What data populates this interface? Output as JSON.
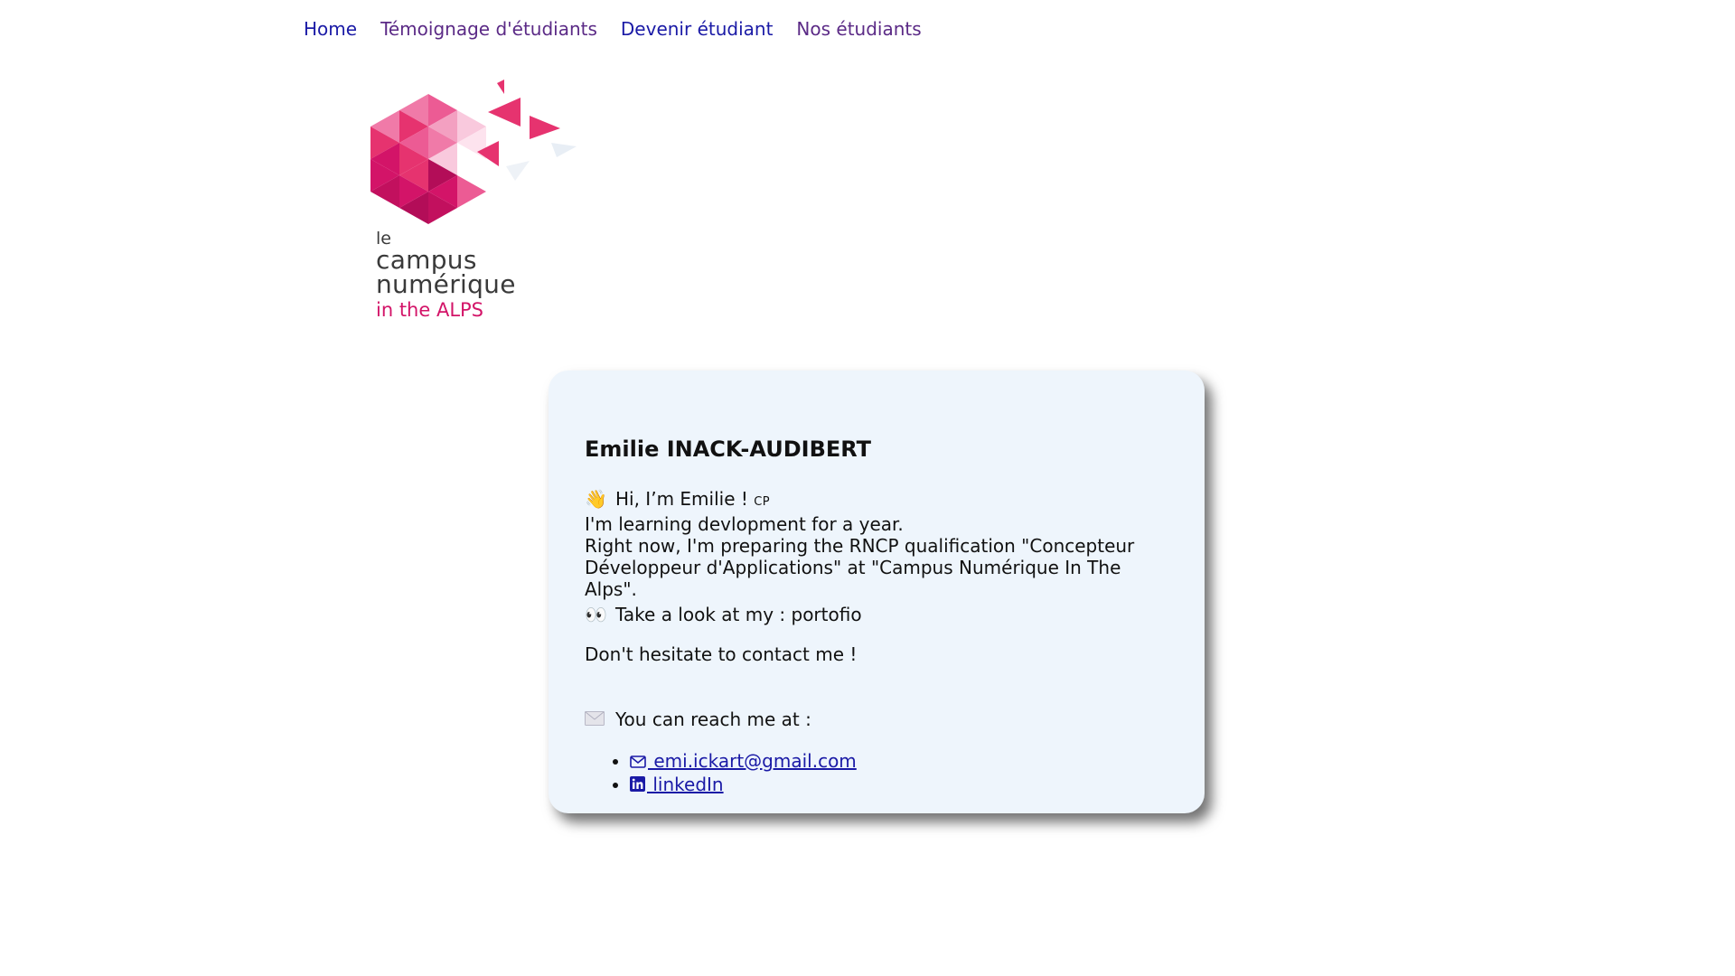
{
  "nav": {
    "items": [
      {
        "label": "Home",
        "state": "link"
      },
      {
        "label": "Témoignage d'étudiants",
        "state": "visited"
      },
      {
        "label": "Devenir étudiant",
        "state": "link"
      },
      {
        "label": "Nos étudiants",
        "state": "visited"
      }
    ]
  },
  "logo": {
    "le": "le",
    "line1": "campus",
    "line2": "numérique",
    "line3": "in the ALPS",
    "colors": {
      "pink": "#e6336f",
      "magenta": "#d31468",
      "text": "#3a3a3a"
    }
  },
  "card": {
    "title": "Emilie INACK-AUDIBERT",
    "greeting": "Hi, I’m Emilie !",
    "greeting_suffix": "CP",
    "greeting_icon": "waving-hand-icon",
    "learning": "I'm learning devlopment for a year.",
    "preparing": "Right now, I'm preparing the RNCP qualification \"Concepteur Développeur d'Applications\" at \"Campus Numérique In The Alps\".",
    "portfolio_icon": "eyes-icon",
    "portfolio": "Take a look at my : portofio",
    "contact": "Don't hesitate to contact me !",
    "reach_icon": "envelope-icon",
    "reach": "You can reach me at :",
    "links": [
      {
        "icon": "mail-icon",
        "label": " emi.ickart@gmail.com"
      },
      {
        "icon": "linkedin-icon",
        "label": " linkedIn"
      }
    ]
  },
  "colors": {
    "link": "#1a1aa6",
    "visited": "#5b2a86",
    "card_bg": "#eef5fc"
  }
}
